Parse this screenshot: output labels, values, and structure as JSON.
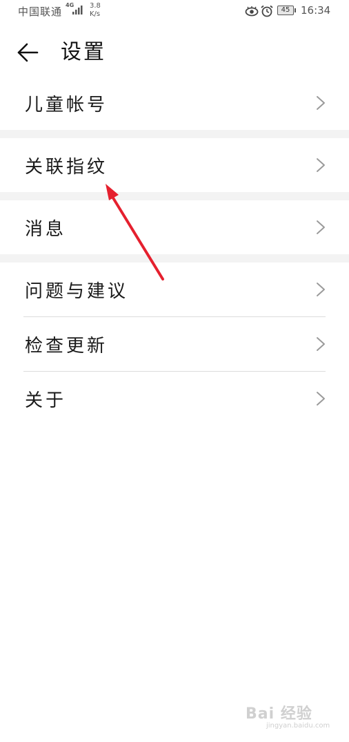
{
  "status_bar": {
    "carrier": "中国联通",
    "network_type": "4G",
    "speed_value": "3.8",
    "speed_unit": "K/s",
    "battery": "45",
    "time": "16:34",
    "icons": [
      "signal-icon",
      "eye-icon",
      "alarm-icon",
      "battery-icon"
    ]
  },
  "header": {
    "title": "设置",
    "back_icon": "arrow-left-icon"
  },
  "settings": {
    "items": [
      {
        "label": "儿童帐号"
      },
      {
        "label": "关联指纹"
      },
      {
        "label": "消息"
      },
      {
        "label": "问题与建议"
      },
      {
        "label": "检查更新"
      },
      {
        "label": "关于"
      }
    ]
  },
  "watermark": {
    "main": "Bai 经验",
    "sub": "jingyan.baidu.com"
  },
  "colors": {
    "background": "#ffffff",
    "section_gap": "#f3f3f3",
    "divider": "#dcdcdc",
    "annotation": "#e5202e"
  }
}
